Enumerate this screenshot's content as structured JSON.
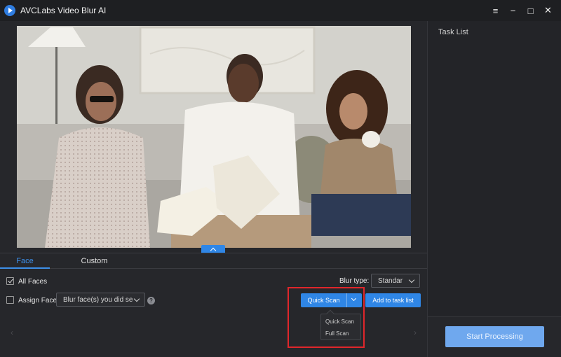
{
  "window": {
    "title": "AVCLabs Video Blur AI",
    "controls": {
      "menu": "≡",
      "minimize": "−",
      "maximize": "□",
      "close": "✕"
    }
  },
  "tabs": [
    {
      "label": "Face",
      "active": true
    },
    {
      "label": "Custom",
      "active": false
    }
  ],
  "options": {
    "all_faces": {
      "label": "All Faces",
      "checked": true
    },
    "assign_face": {
      "label": "Assign Face",
      "checked": false,
      "select_value": "Blur face(s) you did se"
    },
    "blur_type": {
      "label": "Blur type:",
      "value": "Standar"
    }
  },
  "buttons": {
    "quick_scan": "Quick Scan",
    "add_to_task": "Add to task list",
    "start_processing": "Start Processing"
  },
  "scan_menu": [
    "Quick Scan",
    "Full Scan"
  ],
  "task_panel": {
    "title": "Task List"
  },
  "help_glyph": "?",
  "colors": {
    "accent": "#2f86e6",
    "highlight": "#e0262b",
    "start_button": "#6fa8ee"
  }
}
